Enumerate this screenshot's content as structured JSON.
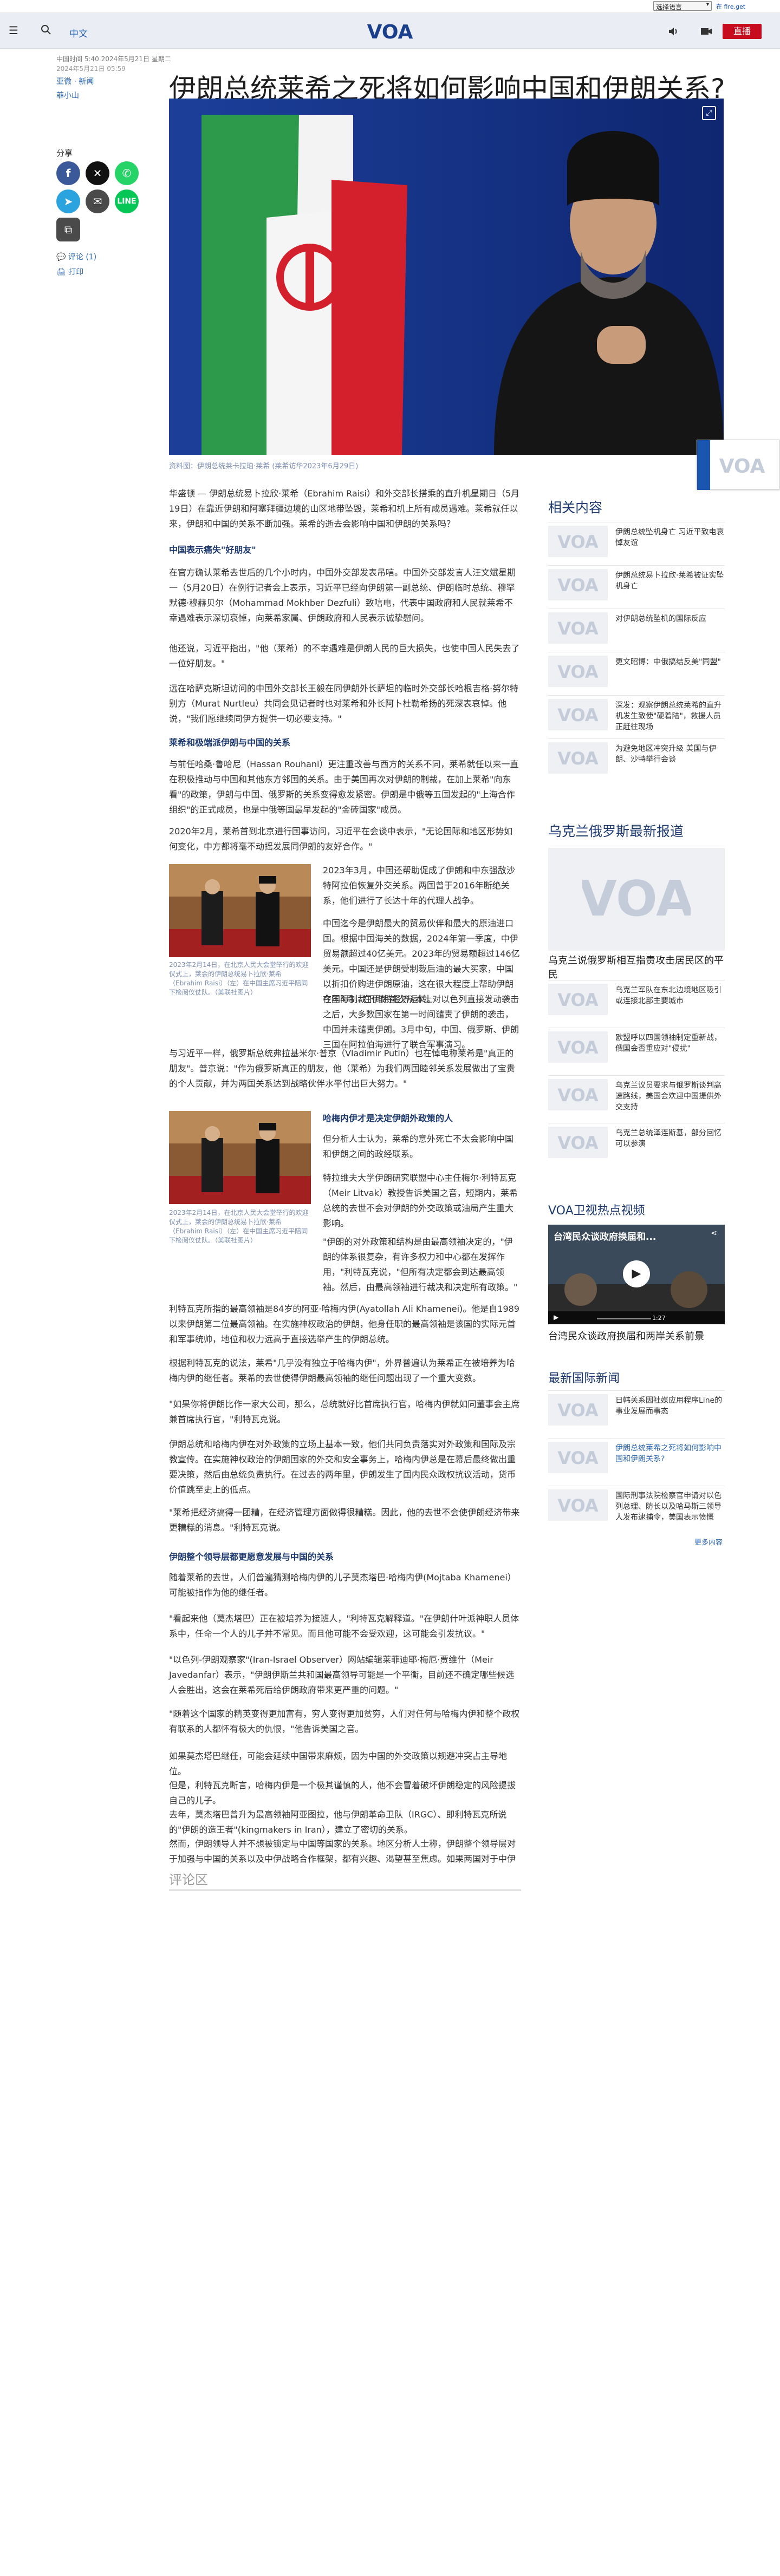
{
  "top": {
    "language_select": "选择语言",
    "keyboard_link": "在 fire.get"
  },
  "header": {
    "nav_language": "中文",
    "logo_text": "VOA",
    "live_label": "直播"
  },
  "article": {
    "meta": "中国时间 5:40 2024年5月21日 星期二",
    "byline1": "亚微 · 新闻",
    "byline2": "菲小山",
    "date": "2024年5月21日 05:59",
    "title": "伊朗总统莱希之死将如何影响中国和伊朗关系?",
    "share_label": "分享",
    "share_comment": "评论 (1)",
    "share_print": "打印",
    "hero_caption": "资料图：伊朗总统莱卡拉珀·莱希 (莱希访华2023年6月29日)",
    "paragraphs": [
      "华盛顿 — 伊朗总统易卜拉欣·莱希（Ebrahim Raisi）和外交部长搭乘的直升机星期日（5月19日）在靠近伊朗和阿塞拜疆边境的山区地带坠毁，莱希和机上所有成员遇难。莱希就任以来，伊朗和中国的关系不断加强。莱希的逝去会影响中国和伊朗的关系吗？",
      "中国表示痛失\"好朋友\"",
      "在官方确认莱希去世后的几个小时内，中国外交部发表吊唁。中国外交部发言人汪文斌星期一（5月20日）在例行记者会上表示，习近平已经向伊朗第一副总统、伊朗临时总统、穆罕默德·穆赫贝尔（Mohammad Mokhber Dezfuli）致唁电，代表中国政府和人民就莱希不幸遇难表示深切哀悼，向莱希家属、伊朗政府和人民表示诚挚慰问。",
      "他还说，习近平指出，\"他（莱希）的不幸遇难是伊朗人民的巨大损失，也使中国人民失去了一位好朋友。\"",
      "远在哈萨克斯坦访问的中国外交部长王毅在同伊朗外长萨坦的临时外交部长哈根吉格·努尔特别方（Murat Nurtleu）共同会见记者时也对莱希和外长阿卜杜勒希扬的死深表哀悼。他说，\"我们愿继续同伊方提供一切必要支持。\"",
      "莱希和极端派伊朗与中国的关系",
      "与前任哈桑·鲁哈尼（Hassan Rouhani）更注重改善与西方的关系不同，莱希就任以来一直在积极推动与中国和其他东方邻国的关系。由于美国再次对伊朗的制裁，在加上莱希\"向东看\"的政策，伊朗与中国、俄罗斯的关系变得愈发紧密。伊朗是中俄等五国发起的\"上海合作组织\"的正式成员，也是中俄等国最早发起的\"金砖国家\"成员。",
      "2020年2月，莱希首到北京进行国事访问，习近平在会谈中表示，\"无论国际和地区形势如何变化，中方都将毫不动摇发展同伊朗的友好合作。\"",
      "2023年3月，中国还帮助促成了伊朗和中东强敌沙特阿拉伯恢复外交关系。两国曾于2016年断绝关系，他们进行了长达十年的代理人战争。",
      "中国迄今是伊朗最大的贸易伙伴和最大的原油进口国。根据中国海关的数据，2024年第一季度，中伊贸易额超过40亿美元。2023年的贸易额超过146亿美元。中国还是伊朗受制裁后油的最大买家，中国以折扣价购进伊朗原油，这在很大程度上帮助伊朗在国际制裁下维持经济运转。",
      "今年4月，在伊朗首次从本土对以色列直接发动袭击之后，大多数国家在第一时间谴责了伊朗的袭击，中国并未谴责伊朗。3月中旬，中国、俄罗斯、伊朗三国在阿拉伯海进行了联合军事演习。",
      "与习近平一样，俄罗斯总统弗拉基米尔·普京（Vladimir Putin）也在悼电称莱希是\"真正的朋友\"。普京说：\"作为俄罗斯真正的朋友，他（莱希）为我们两国睦邻关系发展做出了宝贵的个人贡献，并为两国关系达到战略伙伴水平付出巨大努力。\"",
      "哈梅内伊才是决定伊朗外政策的人",
      "但分析人士认为，莱希的意外死亡不太会影响中国和伊朗之间的政经联系。",
      "特拉维夫大学伊朗研究联盟中心主任梅尔·利特瓦克（Meir Litvak）教授告诉美国之音，短期内，莱希总统的去世不会对伊朗的外交政策或油局产生重大影响。",
      "\"伊朗的对外政策和结构是由最高领袖决定的，\"伊朗的体系很复杂，有许多权力和中心都在发挥作用，\"利特瓦克说，\"但所有决定都会到达最高领袖。然后，由最高领袖进行裁决和决定所有政策。\"",
      "利特瓦克所指的最高领袖是84岁的阿亚·哈梅内伊(Ayatollah Ali Khamenei)。他是自1989 以来伊朗第二位最高领袖。在实施神权政治的伊朗，他身任职的最高领袖是该国的实际元首和军事统帅，地位和权力远高于直接选举产生的伊朗总统。",
      "根据利特瓦克的说法，莱希\"几乎没有独立于哈梅内伊\"，外界普遍认为莱希正在被培养为哈梅内伊的继任者。莱希的去世使得伊朗最高领袖的继任问题出现了一个重大变数。",
      "\"如果你将伊朗比作一家大公司，那么，总统就好比首席执行官，哈梅内伊就如同董事会主席兼首席执行官，\"利特瓦克说。",
      "伊朗总统和哈梅内伊在对外政策的立场上基本一致，他们共同负责落实对外政策和国际及宗教宣传。在实施神权政治的伊朗国家的外交和安全事务上，哈梅内伊总是在幕后最终做出重要决策，然后由总统负责执行。在过去的两年里，伊朗发生了国内民众政权抗议活动，货币价值跳至史上的低点。",
      "\"莱希把经济搞得一团糟，在经济管理方面做得很糟糕。因此，他的去世不会使伊朗经济带来更糟糕的消息。\"利特瓦克说。",
      "伊朗整个领导层都更愿意发展与中国的关系",
      "随着莱希的去世，人们普遍猜测哈梅内伊的儿子莫杰塔巴·哈梅内伊(Mojtaba Khamenei）可能被指作为他的继任者。",
      "\"看起来他（莫杰塔巴）正在被培养为接班人，\"利特瓦克解释道。\"在伊朗什叶派神职人员体系中，任命一个人的儿子并不常见。而且他可能不会受欢迎，这可能会引发抗议。\"",
      "\"以色列-伊朗观察家\"(Iran-Israel Observer）网站编辑莱菲迪耶·梅厄·贾维什（Meir Javedanfar）表示，\"伊朗伊斯兰共和国最高领导可能是一个平衡，目前还不确定哪些候选人会胜出，这会在莱希死后给伊朗政府带来更严重的问题。\"",
      "\"随着这个国家的精英变得更加富有，穷人变得更加贫穷，人们对任何与哈梅内伊和整个政权有联系的人都怀有极大的仇恨，\"他告诉美国之音。",
      "如果莫杰塔巴继任，可能会延续中国带来麻烦，因为中国的外交政策以规避冲突占主导地位。",
      "但是，利特瓦克断言，哈梅内伊是一个极其谨慎的人，他不会冒着破坏伊朗稳定的风险提拔自己的儿子。",
      "去年，莫杰塔巴曾升为最高领袖阿亚图拉，他与伊朗革命卫队（IRGC）、即利特瓦克所说的\"伊朗的造王者\"(kingmakers in Iran），建立了密切的关系。",
      "然而，伊朗领导人并不想被锁定与中国等国家的关系。地区分析人士称，伊朗整个领导层对于加强与中国的关系以及中伊战略合作框架，都有兴趣、渴望甚至焦虑。如果两国对于中伊关系的走向的有犹豫之处，这种犹豫来自中国一方。"
    ],
    "inline_image1_caption": "2023年2月14日，在北京人民大会堂举行的欢迎仪式上，莱会的伊朗总统易卜拉欣·莱希（Ebrahim Raisi）（左）在中国主席习近平陪同下检阅仪仗队。（美联社图片）",
    "inline_image2_caption": "2023年2月14日，在北京人民大会堂举行的欢迎仪式上，莱会的伊朗总统易卜拉欣·莱希（Ebrahim Raisi）（左）在中国主席习近平陪同下检阅仪仗队。（美联社图片）",
    "comments_label": "评论区"
  },
  "sidebar": {
    "related_title": "相关内容",
    "related": [
      "伊朗总统坠机身亡 习近平致电哀悼友谊",
      "伊朗总统易卜拉欣·莱希被证实坠机身亡",
      "对伊朗总统坠机的国际反应",
      "更文昭博：中俄搞结反美\"同盟\"",
      "深发：观察伊朗总统莱希的直升机发生致使\"硬着陆\"，救援人员正赶往现场",
      "为避免地区冲突升级 美国与伊朗、沙特举行会谈"
    ],
    "ukraine_title": "乌克兰俄罗斯最新报道",
    "ukraine_feature": "乌克兰说俄罗斯相互指责攻击居民区的平民",
    "ukraine": [
      "乌克兰军队在东北边境地区吸引或连接北部主要城市",
      "欧盟呼以四国领袖制定重新战，俄国会否重应对\"侵扰\"",
      "乌克兰议员要求与俄罗斯谈判高速路线，美国会欢迎中国提供外交支持",
      "乌克兰总统泽连斯基，部分回忆可以参演"
    ],
    "video_title": "VOA卫视热点视频",
    "video_overlay": "台湾民众谈政府换届和...",
    "video_time": "1:27",
    "video_caption": "台湾民众谈政府换届和两岸关系前景",
    "intl_title": "最新国际新闻",
    "intl": [
      "日韩关系因社媒应用程序Line的事业发展而事态",
      "伊朗总统莱希之死将如何影响中国和伊朗关系?",
      "国际刑事法院检察官申请对以色列总理、防长以及哈马斯三领导人发布逮捕令，美国表示愤慨"
    ],
    "more_label": "更多内容"
  },
  "colors": {
    "accent": "#2e67b1",
    "live": "#c60c1e",
    "heading": "#1d3a70"
  },
  "icons": [
    "menu-icon",
    "search-icon",
    "audio-icon",
    "video-icon",
    "facebook-icon",
    "x-icon",
    "whatsapp-icon",
    "telegram-icon",
    "email-icon",
    "line-icon",
    "copy-link-icon",
    "comment-icon",
    "print-icon",
    "expand-icon",
    "play-icon"
  ]
}
